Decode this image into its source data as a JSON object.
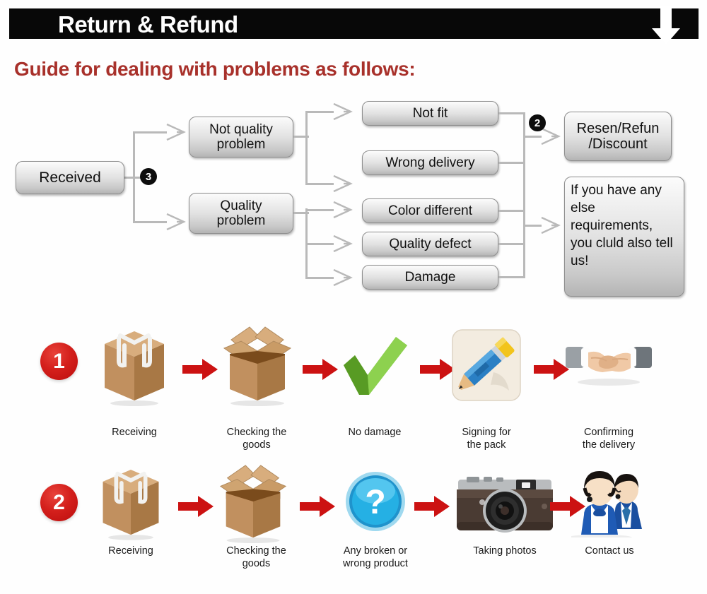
{
  "header": {
    "title": "Return & Refund",
    "arrow_icon": "down-arrow-icon",
    "guide_title": "Guide for dealing with problems as follows:"
  },
  "flowchart": {
    "start": {
      "label": "Received"
    },
    "badges": [
      {
        "name": "step-badge-3",
        "label": "3"
      },
      {
        "name": "step-badge-2",
        "label": "2"
      }
    ],
    "branches": [
      {
        "label": "Not quality\nproblem",
        "line1": "Not quality",
        "line2": "problem"
      },
      {
        "label": "Quality\nproblem",
        "line1": "Quality",
        "line2": "problem"
      }
    ],
    "issues": [
      {
        "label": "Not fit"
      },
      {
        "label": "Wrong delivery"
      },
      {
        "label": "Color different"
      },
      {
        "label": "Quality defect"
      },
      {
        "label": "Damage"
      }
    ],
    "outcomes": [
      {
        "line1": "Resen/Refun",
        "line2": "/Discount"
      },
      {
        "lines": "If you have any else requirements, you cluld also tell us!"
      }
    ]
  },
  "process_rows": [
    {
      "badge": "1",
      "steps": [
        {
          "icon": "closed-box-icon",
          "caption_line1": "Receiving",
          "caption_line2": ""
        },
        {
          "icon": "open-box-icon",
          "caption_line1": "Checking the",
          "caption_line2": "goods"
        },
        {
          "icon": "green-check-icon",
          "caption_line1": "No damage",
          "caption_line2": ""
        },
        {
          "icon": "pencil-sign-icon",
          "caption_line1": "Signing for",
          "caption_line2": "the pack"
        },
        {
          "icon": "handshake-icon",
          "caption_line1": "Confirming",
          "caption_line2": "the delivery"
        }
      ]
    },
    {
      "badge": "2",
      "steps": [
        {
          "icon": "closed-box-icon",
          "caption_line1": "Receiving",
          "caption_line2": ""
        },
        {
          "icon": "open-box-icon",
          "caption_line1": "Checking the",
          "caption_line2": "goods"
        },
        {
          "icon": "blue-question-icon",
          "caption_line1": "Any broken or",
          "caption_line2": "wrong product"
        },
        {
          "icon": "camera-icon",
          "caption_line1": "Taking photos",
          "caption_line2": ""
        },
        {
          "icon": "support-agents-icon",
          "caption_line1": "Contact us",
          "caption_line2": ""
        }
      ]
    }
  ],
  "colors": {
    "header_bg": "#080808",
    "guide_red": "#a8312b",
    "arrow_red": "#cc1212",
    "box_gray": "#e2e2e2",
    "connector_gray": "#b9b9b9",
    "check_green": "#7dc242",
    "cardboard": "#c69c6d",
    "question_blue": "#1ba4d8"
  }
}
